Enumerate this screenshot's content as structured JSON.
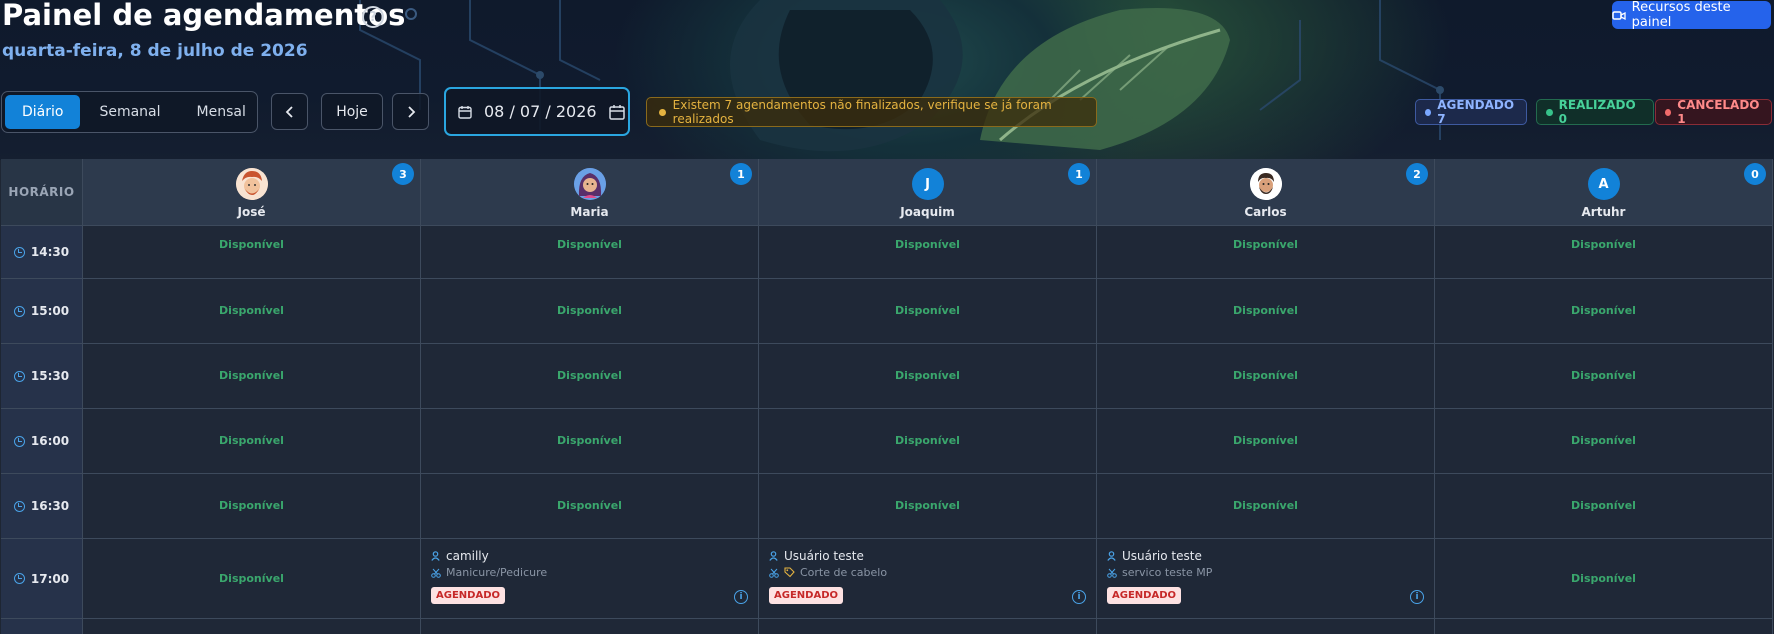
{
  "header": {
    "title": "Painel de agendamentos",
    "subtitle": "quarta-feira, 8 de julho de 2026",
    "help_icon": "help-circle-icon",
    "resources_button": "Recursos deste painel"
  },
  "toolbar": {
    "views": [
      "Diário",
      "Semanal",
      "Mensal"
    ],
    "active_view": "Diário",
    "today_label": "Hoje",
    "date_value": "08 / 07 / 2026",
    "warning": "Existem 7 agendamentos não finalizados, verifique se já foram realizados"
  },
  "legend": {
    "scheduled": "AGENDADO 7",
    "done": "REALIZADO 0",
    "cancelled": "CANCELADO 1"
  },
  "colors": {
    "accent": "#1282d8",
    "available": "#3aa76d",
    "warning": "#e5b340",
    "scheduled": "#7aa7ff",
    "done": "#37c28a",
    "cancelled": "#f06b6b"
  },
  "grid": {
    "time_header": "HORÁRIO",
    "professionals": [
      {
        "name": "José",
        "count": "3",
        "initial": ""
      },
      {
        "name": "Maria",
        "count": "1",
        "initial": ""
      },
      {
        "name": "Joaquim",
        "count": "1",
        "initial": "J"
      },
      {
        "name": "Carlos",
        "count": "2",
        "initial": ""
      },
      {
        "name": "Artuhr",
        "count": "0",
        "initial": "A"
      }
    ],
    "available_label": "Disponível",
    "times": [
      "14:30",
      "15:00",
      "15:30",
      "16:00",
      "16:30",
      "17:00"
    ],
    "appointments": [
      {
        "client": "camilly",
        "service": "Manicure/Pedicure",
        "status": "AGENDADO"
      },
      {
        "client": "Usuário teste",
        "service": "Corte de cabelo",
        "status": "AGENDADO"
      },
      {
        "client": "Usuário teste",
        "service": "servico teste MP",
        "status": "AGENDADO"
      }
    ]
  }
}
